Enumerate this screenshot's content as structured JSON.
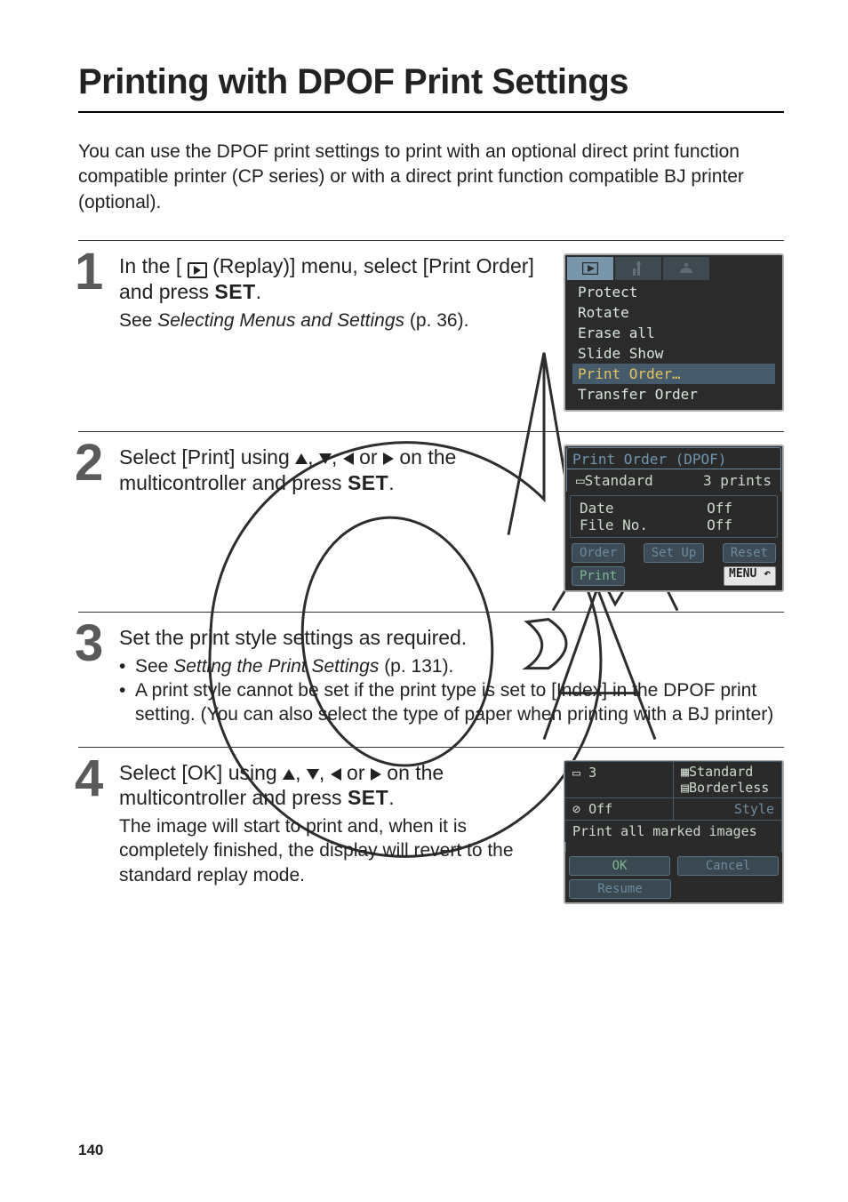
{
  "title": "Printing with DPOF Print Settings",
  "intro": "You can use the DPOF print settings to print with an optional direct print function compatible printer (CP series) or with a direct print function compatible BJ printer (optional).",
  "ui": {
    "set": "SET",
    "or": " or "
  },
  "steps": [
    {
      "num": "1",
      "head_a": "In the [",
      "head_b": " (Replay)] menu, select [Print Order] and press ",
      "head_c": ".",
      "body_a": "See ",
      "body_b": "Selecting Menus and Settings",
      "body_c": " (p. 36).",
      "menu": [
        "Protect",
        "Rotate",
        "Erase all",
        "Slide Show",
        "Print Order",
        "Transfer Order"
      ]
    },
    {
      "num": "2",
      "head_a": "Select [Print] using ",
      "head_b": " on the multicontroller and press ",
      "lcd": {
        "header": "Print Order (DPOF)",
        "standard": "Standard",
        "prints": "3 prints",
        "date_label": "Date",
        "date_val": "Off",
        "fileno_label": "File No.",
        "fileno_val": "Off",
        "order": "Order",
        "setup": "Set Up",
        "reset": "Reset",
        "print": "Print",
        "menu": "MENU"
      }
    },
    {
      "num": "3",
      "head": "Set the print style settings as required.",
      "b1a": "See ",
      "b1b": "Setting the Print Settings",
      "b1c": " (p. 131).",
      "b2": "A print style cannot be set if the print type is set to [Index] in the DPOF print setting. (You can also select the type of paper when printing with a BJ printer)"
    },
    {
      "num": "4",
      "head_a": "Select [OK] using ",
      "head_b": " on the multicontroller and press ",
      "body": "The image will start to print and, when it is completely finished, the display will revert to the standard replay mode.",
      "lcd": {
        "copies": "3",
        "standard": "Standard",
        "borderless": "Borderless",
        "off": "Off",
        "style": "Style",
        "msg": "Print all marked images",
        "ok": "OK",
        "cancel": "Cancel",
        "resume": "Resume"
      }
    }
  ],
  "page": "140"
}
